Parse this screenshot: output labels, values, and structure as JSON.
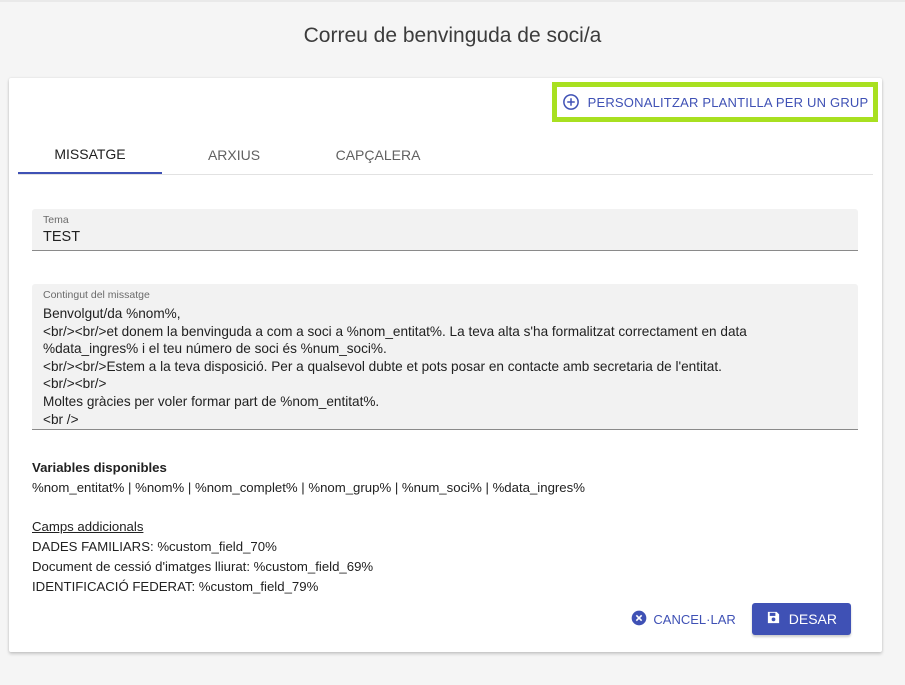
{
  "page": {
    "title": "Correu de benvinguda de soci/a"
  },
  "header": {
    "customize_label": "PERSONALITZAR PLANTILLA PER UN GRUP"
  },
  "tabs": [
    {
      "label": "MISSATGE",
      "active": true
    },
    {
      "label": "ARXIUS",
      "active": false
    },
    {
      "label": "CAPÇALERA",
      "active": false
    }
  ],
  "subject": {
    "label": "Tema",
    "value": "TEST"
  },
  "message": {
    "label": "Contingut del missatge",
    "lines": [
      "Benvolgut/da %nom%,",
      "<br/><br/>et donem la benvinguda a com a soci a %nom_entitat%. La teva alta s'ha formalitzat correctament en data",
      "%data_ingres% i el teu número de soci és %num_soci%.",
      "<br/><br/>Estem a la teva disposició. Per a qualsevol dubte et pots posar en contacte amb secretaria de l'entitat.",
      "<br/><br/>",
      "Moltes gràcies per voler formar part de %nom_entitat%.",
      "<br />"
    ]
  },
  "variables": {
    "heading": "Variables disponibles",
    "list": "%nom_entitat% | %nom% | %nom_complet% | %nom_grup% | %num_soci% | %data_ingres%"
  },
  "custom_fields": {
    "heading": "Camps addicionals",
    "items": [
      "DADES FAMILIARS: %custom_field_70%",
      "Document de cessió d'imatges lliurat: %custom_field_69%",
      "IDENTIFICACIÓ FEDERAT: %custom_field_79%"
    ]
  },
  "actions": {
    "cancel_label": "CANCEL·LAR",
    "save_label": "DESAR"
  },
  "colors": {
    "primary": "#3f51b5",
    "highlight": "#a8e020"
  },
  "icons": {
    "customize": "add-circle-outline-icon",
    "cancel": "cancel-circle-icon",
    "save": "floppy-disk-icon"
  }
}
